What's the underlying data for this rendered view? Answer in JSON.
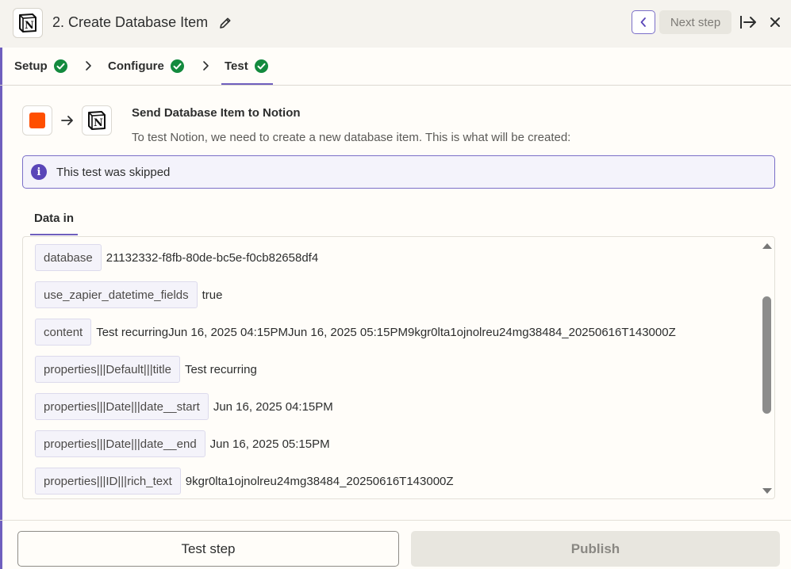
{
  "header": {
    "step_number": "2.",
    "title": "Create Database Item",
    "next_step_label": "Next step",
    "app_logo_letter": "N"
  },
  "tabs": [
    {
      "label": "Setup",
      "status": "complete"
    },
    {
      "label": "Configure",
      "status": "complete"
    },
    {
      "label": "Test",
      "status": "complete",
      "active": true
    }
  ],
  "summary": {
    "title": "Send Database Item to Notion",
    "description": "To test Notion, we need to create a new database item. This is what will be created:"
  },
  "alert": {
    "icon": "info-icon",
    "text": "This test was skipped"
  },
  "data_tab": {
    "label": "Data in"
  },
  "data_rows": [
    {
      "key": "database",
      "value": "21132332-f8fb-80de-bc5e-f0cb82658df4"
    },
    {
      "key": "use_zapier_datetime_fields",
      "value": "true"
    },
    {
      "key": "content",
      "value": "Test recurringJun 16, 2025 04:15PMJun 16, 2025 05:15PM9kgr0lta1ojnolreu24mg38484_20250616T143000Z"
    },
    {
      "key": "properties|||Default|||title",
      "value": "Test recurring"
    },
    {
      "key": "properties|||Date|||date__start",
      "value": "Jun 16, 2025 04:15PM"
    },
    {
      "key": "properties|||Date|||date__end",
      "value": "Jun 16, 2025 05:15PM"
    },
    {
      "key": "properties|||ID|||rich_text",
      "value": "9kgr0lta1ojnolreu24mg38484_20250616T143000Z"
    }
  ],
  "footer": {
    "test_button_label": "Test step",
    "publish_button_label": "Publish"
  },
  "colors": {
    "accent": "#6f5fbe",
    "success": "#138a3e",
    "trigger_brand": "#ff4f00"
  }
}
